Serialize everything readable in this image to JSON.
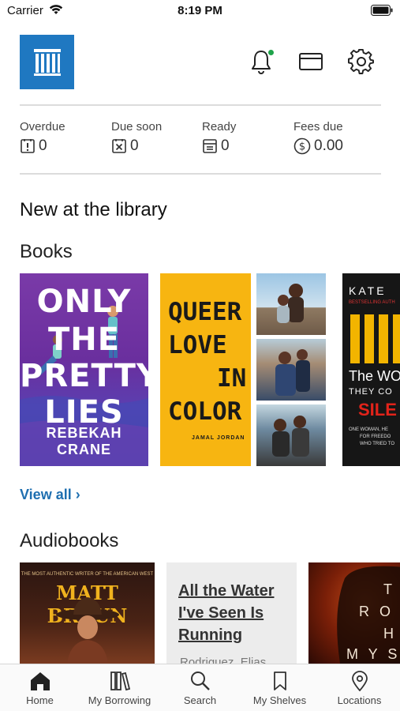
{
  "status_bar": {
    "carrier": "Carrier",
    "time": "8:19 PM"
  },
  "header": {
    "logo_icon": "library-columns-logo",
    "icons": [
      "bell-icon",
      "library-card-icon",
      "gear-icon"
    ],
    "notification_dot_color": "#1fa34a"
  },
  "stats": [
    {
      "label": "Overdue",
      "icon": "alert-box-icon",
      "value": "0"
    },
    {
      "label": "Due soon",
      "icon": "x-box-icon",
      "value": "0"
    },
    {
      "label": "Ready",
      "icon": "tray-icon",
      "value": "0"
    },
    {
      "label": "Fees due",
      "icon": "dollar-circle-icon",
      "value": "0.00"
    }
  ],
  "main": {
    "section_title": "New at the library",
    "books": {
      "title": "Books",
      "covers": [
        {
          "title_lines": [
            "ONLY",
            "THE",
            "PRETTY",
            "LIES"
          ],
          "author": "REBEKAH CRANE"
        },
        {
          "title_lines": [
            "QUEER",
            "LOVE",
            "IN",
            "COLOR"
          ],
          "author": "JAMAL JORDAN"
        },
        {
          "author_fragment": "KATE",
          "badge": "BESTSELLING AUTH",
          "title_fragments": [
            "The WO",
            "THEY CO",
            "SILE"
          ],
          "small_lines": [
            "ONE WOMAN, HE",
            "FOR FREEDO",
            "WHO TRIED TO"
          ]
        }
      ],
      "view_all": "View all ›"
    },
    "audiobooks": {
      "title": "Audiobooks",
      "items": [
        {
          "tagline": "THE MOST AUTHENTIC WRITER OF THE AMERICAN WEST",
          "author": "MATT BRAUN"
        },
        {
          "title_lines": [
            "All the Water",
            "I've Seen Is",
            "Running"
          ],
          "author": "Rodriguez, Elias"
        },
        {
          "letters": [
            "T",
            "R O",
            "H",
            "M Y S"
          ]
        }
      ]
    }
  },
  "tabbar": {
    "tabs": [
      {
        "label": "Home",
        "icon": "home-icon"
      },
      {
        "label": "My Borrowing",
        "icon": "books-icon"
      },
      {
        "label": "Search",
        "icon": "search-icon"
      },
      {
        "label": "My Shelves",
        "icon": "bookmark-icon"
      },
      {
        "label": "Locations",
        "icon": "location-pin-icon"
      }
    ]
  }
}
